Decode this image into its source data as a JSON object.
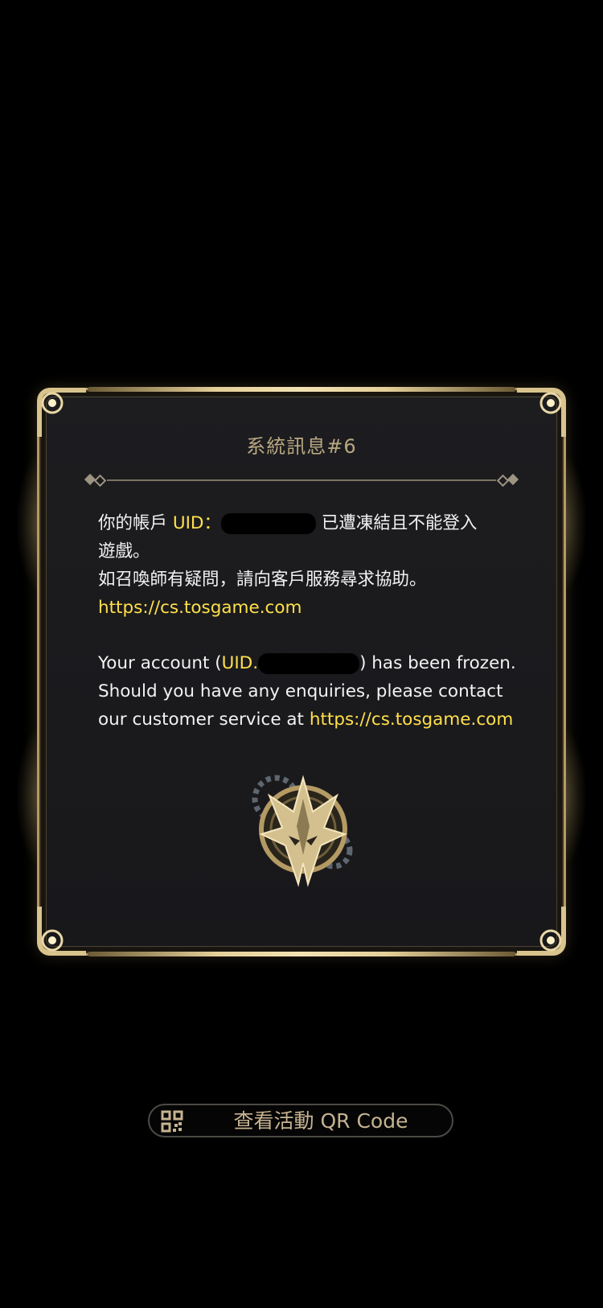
{
  "dialog": {
    "title": "系統訊息#6",
    "zh": {
      "line1_pre": "你的帳戶",
      "uid_label": "UID：",
      "line1_post": "已遭凍結且不能登入",
      "line2": "遊戲。",
      "line3": "如召喚師有疑問，請向客戶服務尋求協助。",
      "link": "https://cs.tosgame.com"
    },
    "en": {
      "line1_pre": "Your account (",
      "uid_label": "UID.",
      "line1_post": ") has been frozen.",
      "line2": "Should you have any enquiries, please contact",
      "line3_pre": "our customer service at",
      "link": "https://cs.tosgame.com"
    }
  },
  "qr_button": {
    "icon": "qr-code-icon",
    "label": "查看活動 QR Code"
  },
  "colors": {
    "background": "#000000",
    "panel": "#1b1b1e",
    "gold": "#b49a63",
    "link_yellow": "#ffe04a",
    "title": "#b9a881"
  }
}
